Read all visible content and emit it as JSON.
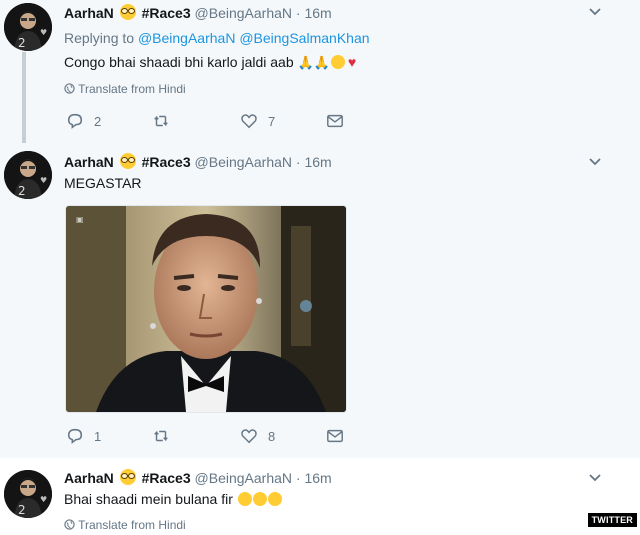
{
  "tweets": [
    {
      "name": "AarhaN",
      "tag": "#Race3",
      "handle": "@BeingAarhaN",
      "time": "· 16m",
      "replying_prefix": "Replying to ",
      "replying_to_1": "@BeingAarhaN",
      "replying_to_2": "@BeingSalmanKhan",
      "text": "Congo bhai shaadi bhi karlo jaldi aab",
      "translate": "Translate from Hindi",
      "reply_count": "2",
      "like_count": "7"
    },
    {
      "name": "AarhaN",
      "tag": "#Race3",
      "handle": "@BeingAarhaN",
      "time": "· 16m",
      "text": "MEGASTAR",
      "reply_count": "1",
      "like_count": "8"
    },
    {
      "name": "AarhaN",
      "tag": "#Race3",
      "handle": "@BeingAarhaN",
      "time": "· 16m",
      "text": "Bhai shaadi mein bulana fir",
      "translate": "Translate from Hindi"
    }
  ],
  "icons": [
    "chevron-down-icon",
    "reply-icon",
    "retweet-icon",
    "like-icon",
    "message-icon",
    "globe-icon"
  ],
  "colors": {
    "link": "#1b95e0",
    "muted": "#657786",
    "heart": "#e0245e"
  },
  "badge": "TWITTER"
}
